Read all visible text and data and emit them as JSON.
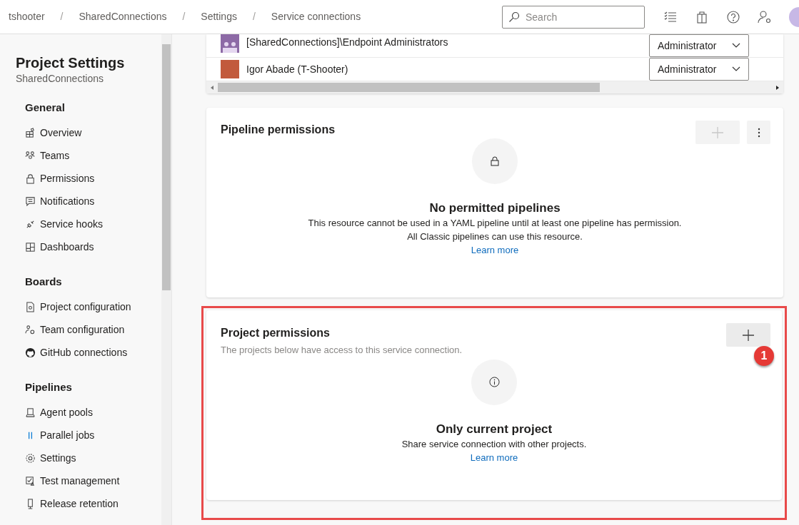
{
  "breadcrumb": [
    {
      "label": "tshooter"
    },
    {
      "separator": "/",
      "label": "SharedConnections"
    },
    {
      "separator": "/",
      "label": "Settings"
    },
    {
      "separator": "/",
      "label": "Service connections"
    }
  ],
  "search": {
    "placeholder": "Search"
  },
  "sidebar": {
    "title": "Project Settings",
    "subtitle": "SharedConnections",
    "sections": [
      {
        "heading": "General",
        "items": [
          "Overview",
          "Teams",
          "Permissions",
          "Notifications",
          "Service hooks",
          "Dashboards"
        ]
      },
      {
        "heading": "Boards",
        "items": [
          "Project configuration",
          "Team configuration",
          "GitHub connections"
        ]
      },
      {
        "heading": "Pipelines",
        "items": [
          "Agent pools",
          "Parallel jobs",
          "Settings",
          "Test management",
          "Release retention"
        ]
      }
    ]
  },
  "members": [
    {
      "kind": "group",
      "name": "[SharedConnections]\\Endpoint Administrators",
      "role": "Administrator"
    },
    {
      "kind": "user",
      "name": "Igor Abade (T-Shooter)",
      "role": "Administrator"
    }
  ],
  "pipeline_permissions": {
    "title": "Pipeline permissions",
    "add_button": {
      "disabled": true
    },
    "empty_state": {
      "kind": "lock",
      "title": "No permitted pipelines",
      "lines": [
        "This resource cannot be used in a YAML pipeline until at least one pipeline has permission.",
        "All Classic pipelines can use this resource."
      ],
      "link": "Learn more"
    }
  },
  "project_permissions": {
    "title": "Project permissions",
    "subtitle": "The projects below have access to this service connection.",
    "add_button": {
      "disabled": false
    },
    "callout": "1",
    "empty_state": {
      "kind": "info",
      "title": "Only current project",
      "lines": [
        "Share service connection with other projects."
      ],
      "link": "Learn more"
    }
  }
}
